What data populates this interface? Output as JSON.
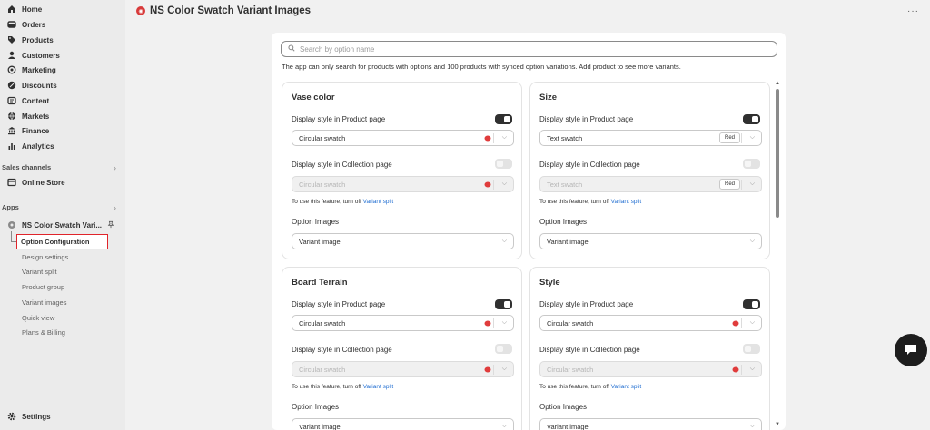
{
  "sidebar": {
    "nav": [
      {
        "label": "Home",
        "icon": "home-icon"
      },
      {
        "label": "Orders",
        "icon": "orders-icon"
      },
      {
        "label": "Products",
        "icon": "tag-icon"
      },
      {
        "label": "Customers",
        "icon": "person-icon"
      },
      {
        "label": "Marketing",
        "icon": "target-icon"
      },
      {
        "label": "Discounts",
        "icon": "discount-icon"
      },
      {
        "label": "Content",
        "icon": "content-icon"
      },
      {
        "label": "Markets",
        "icon": "globe-icon"
      },
      {
        "label": "Finance",
        "icon": "bank-icon"
      },
      {
        "label": "Analytics",
        "icon": "bar-chart-icon"
      }
    ],
    "sales_channels_label": "Sales channels",
    "online_store_label": "Online Store",
    "apps_label": "Apps",
    "app_name": "NS Color Swatch Vari...",
    "sub_items": [
      "Option Configuration",
      "Design settings",
      "Variant split",
      "Product group",
      "Variant images",
      "Quick view",
      "Plans & Billing"
    ],
    "settings_label": "Settings"
  },
  "header": {
    "title": "NS Color Swatch Variant Images",
    "more": "···"
  },
  "search": {
    "placeholder": "Search by option name",
    "value": ""
  },
  "hint": "The app can only search for products with options and 100 products with synced option variations. Add product to see more variants.",
  "labels": {
    "display_product": "Display style in Product page",
    "display_collection": "Display style in Collection page",
    "note_prefix": "To use this feature, turn off ",
    "note_link": "Variant split",
    "option_images": "Option Images"
  },
  "cards": [
    {
      "title": "Vase color",
      "product_style": "Circular swatch",
      "product_enabled": true,
      "collection_style": "Circular swatch",
      "collection_enabled": false,
      "option_images": "Variant image"
    },
    {
      "title": "Size",
      "product_style": "Text swatch",
      "product_chip": "Red",
      "product_enabled": true,
      "collection_style": "Text swatch",
      "collection_chip": "Red",
      "collection_enabled": false,
      "option_images": "Variant image"
    },
    {
      "title": "Board Terrain",
      "product_style": "Circular swatch",
      "product_enabled": true,
      "collection_style": "Circular swatch",
      "collection_enabled": false,
      "option_images": "Variant image"
    },
    {
      "title": "Style",
      "product_style": "Circular swatch",
      "product_enabled": true,
      "collection_style": "Circular swatch",
      "collection_enabled": false,
      "option_images": "Variant image"
    }
  ],
  "colors": {
    "accent": "#303030",
    "link": "#1f6dd1",
    "highlight_border": "#e0242a",
    "swatch": "#e03c3c"
  }
}
